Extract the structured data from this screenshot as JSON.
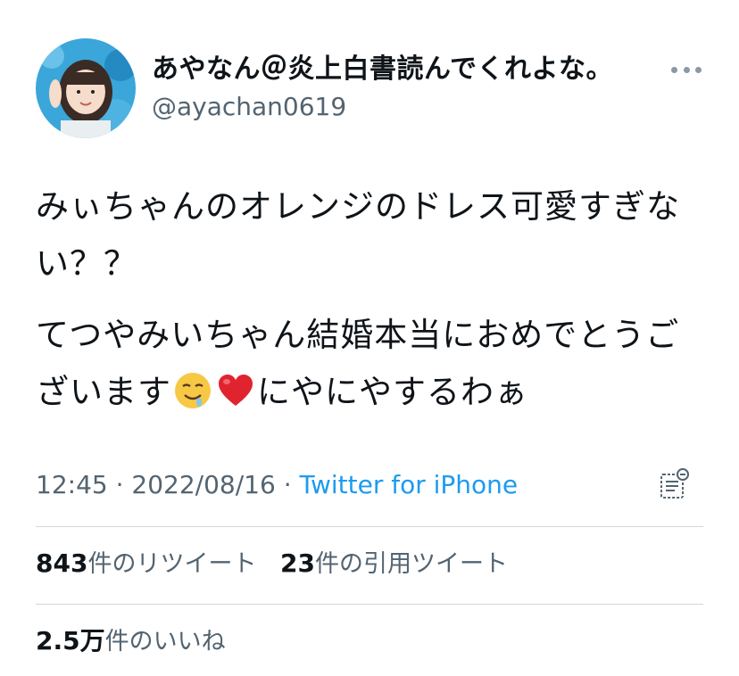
{
  "author": {
    "display_name": "あやなん＠炎上白書読んでくれよな。",
    "handle": "@ayachan0619"
  },
  "tweet": {
    "paragraph1": "みぃちゃんのオレンジのドレス可愛すぎない？？",
    "paragraph2_part1": "てつやみいちゃん結婚本当におめでとうございます",
    "paragraph2_part2": "にやにやするわぁ",
    "emojis": [
      "drooling-face",
      "red-heart"
    ]
  },
  "meta": {
    "time": "12:45",
    "separator": " · ",
    "date": "2022/08/16",
    "source": "Twitter for iPhone"
  },
  "stats": {
    "retweets_count": "843",
    "retweets_label": "件のリツイート",
    "quotes_count": "23",
    "quotes_label": "件の引用ツイート",
    "likes_count": "2.5万",
    "likes_label": "件のいいね"
  },
  "colors": {
    "text": "#0f1419",
    "secondary": "#536471",
    "link": "#1d9bf0",
    "divider": "#cfd9de"
  },
  "icons": [
    "more-icon",
    "analytics-icon"
  ]
}
